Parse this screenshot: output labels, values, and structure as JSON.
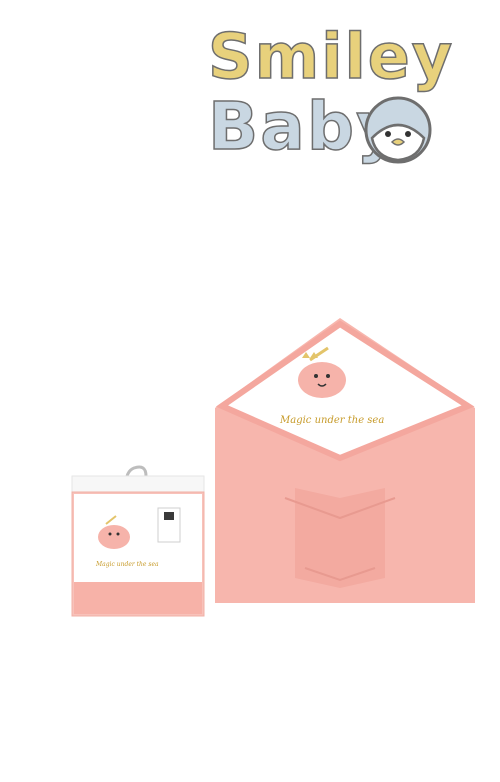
{
  "brand": {
    "line1": "Smiley",
    "line2": "Baby",
    "mascot_icon": "penguin-icon",
    "colors": {
      "line1": "#e8d17c",
      "line2": "#c9d7e2",
      "outline": "#6e6e6e"
    }
  },
  "product": {
    "embroidery_text": "Magic under the sea",
    "colors": {
      "towel": "#f6b3aa",
      "hood": "#ffffff",
      "trim": "#f4a79e",
      "embroidery_gold": "#c79b2a"
    }
  }
}
